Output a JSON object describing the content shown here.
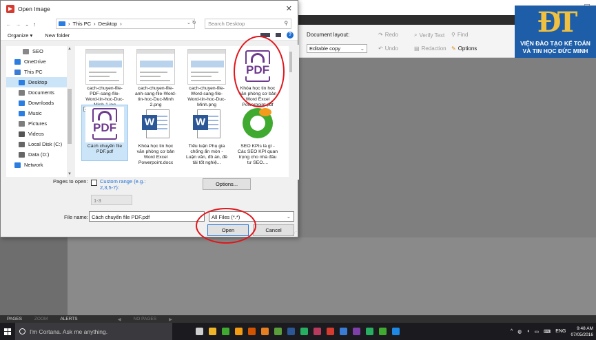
{
  "app": {
    "document_layout_label": "Document layout:",
    "document_layout_value": "Editable copy",
    "redo_label": "Redo",
    "undo_label": "Undo",
    "verify_text_label": "Verify Text",
    "find_label": "Find",
    "redaction_label": "Redaction",
    "options_label": "Options",
    "logo_mark": "ĐT",
    "logo_line1": "VIỆN ĐÀO TẠO KẾ TOÁN",
    "logo_line2": "VÀ TIN HỌC ĐỨC MINH"
  },
  "pagesbar": {
    "pages": "PAGES",
    "zoom": "ZOOM",
    "alerts": "ALERTS",
    "arrow_left": "◀",
    "no_pages": "NO PAGES",
    "arrow_right": "▶"
  },
  "taskbar": {
    "cortana_placeholder": "I'm Cortana. Ask me anything.",
    "language": "ENG",
    "time": "9:48 AM",
    "date": "07/05/2016",
    "app_colors": [
      "#cfcfcf",
      "#f0b429",
      "#3faa2f",
      "#f39c12",
      "#d35400",
      "#e67e22",
      "#5a9e3c",
      "#2b5797",
      "#27ae60",
      "#b83b5e",
      "#d63b2f",
      "#3a7bd5",
      "#7e3fa8",
      "#27ae60",
      "#3faa2f",
      "#1e88e5"
    ]
  },
  "dialog": {
    "title": "Open Image",
    "close": "✕",
    "breadcrumb": [
      "This PC",
      "Desktop"
    ],
    "search_placeholder": "Search Desktop",
    "organize_label": "Organize ▾",
    "new_folder_label": "New folder",
    "nav_items": [
      {
        "label": "SEO",
        "color": "#888888"
      },
      {
        "label": "OneDrive",
        "color": "#2b7de0"
      },
      {
        "label": "This PC",
        "color": "#3a7bd5"
      },
      {
        "label": "Desktop",
        "color": "#2b7de0"
      },
      {
        "label": "Documents",
        "color": "#7d7d7d"
      },
      {
        "label": "Downloads",
        "color": "#2b7de0"
      },
      {
        "label": "Music",
        "color": "#2b7de0"
      },
      {
        "label": "Pictures",
        "color": "#7d7d7d"
      },
      {
        "label": "Videos",
        "color": "#555555"
      },
      {
        "label": "Local Disk (C:)",
        "color": "#666666"
      },
      {
        "label": "Data (D:)",
        "color": "#666666"
      },
      {
        "label": "Network",
        "color": "#2b7de0"
      }
    ],
    "files": [
      {
        "name": "cach-chuyen-file-PDF-sang-file-Word-tin-hoc-Duc-Minh-1.jpg",
        "kind": "shot"
      },
      {
        "name": "cach-chuyen-file-anh-sang-file-Word-tin-hoc-Duc-Minh 2.png",
        "kind": "shot"
      },
      {
        "name": "cach-chuyen-file-Word-sang-file-Word-tin-hoc-Duc-Minh.png",
        "kind": "shot"
      },
      {
        "name": "Khóa học tin học văn phòng cơ bản Word Excel Powerpoint.pdf",
        "kind": "pdf"
      },
      {
        "name": "Cách chuyển file PDF.pdf",
        "kind": "pdf"
      },
      {
        "name": "Khóa học tin học văn phòng cơ bản Word Excel Powerpoint.docx",
        "kind": "word"
      },
      {
        "name": "Tiểu luận Phụ gia chống ẩn mòn - Luận văn, đồ án, đề tài tốt nghiệ...",
        "kind": "word"
      },
      {
        "name": "SEO KPIs là gì - Các SEO KPI quan trọng cho nhà đầu tư SEO....",
        "kind": "coccoc"
      }
    ],
    "pages_to_open_label": "Pages to open:",
    "custom_range_label": "Custom range (e.g.: 2,3,5-7):",
    "range_value": "1-3",
    "options_button": "Options...",
    "file_name_label": "File name:",
    "file_name_value": "Cách chuyển file PDF.pdf",
    "file_type_value": "All Files (*.*)",
    "open_button": "Open",
    "cancel_button": "Cancel"
  },
  "colors": {
    "annotation_red": "#e0161b",
    "selection_blue": "#cce4f7",
    "pdf_purple": "#6d3a8e",
    "logo_blue": "#1e5ea8"
  }
}
